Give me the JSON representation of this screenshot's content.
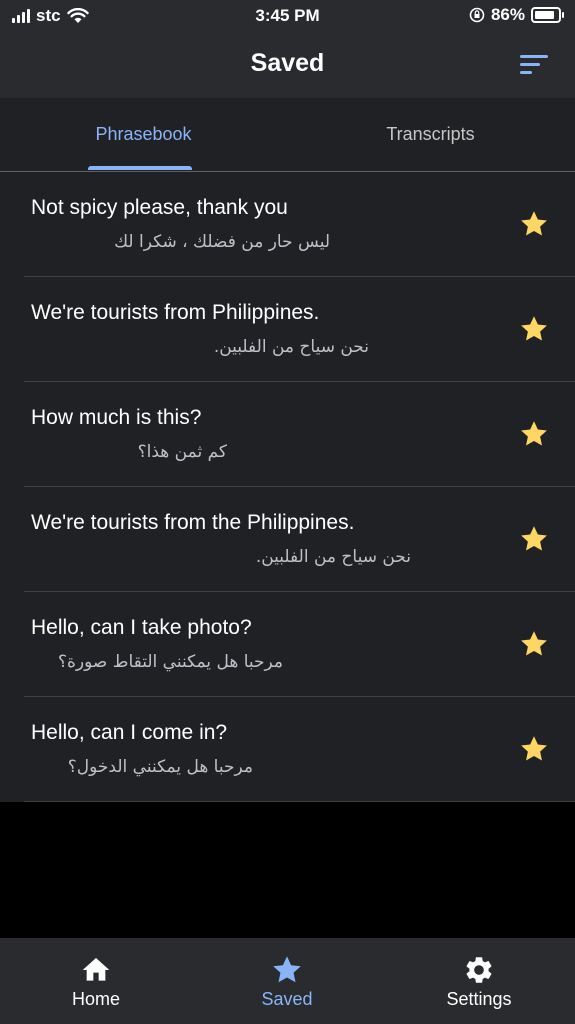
{
  "status_bar": {
    "carrier": "stc",
    "time": "3:45 PM",
    "battery_percent": "86%",
    "battery_level": 0.86
  },
  "header": {
    "title": "Saved",
    "sort_icon": "sort-icon"
  },
  "tabs": [
    {
      "label": "Phrasebook",
      "selected": true
    },
    {
      "label": "Transcripts",
      "selected": false
    }
  ],
  "phrases": [
    {
      "source": "Not spicy please, thank you",
      "translation": "ليس حار من فضلك ، شكرا لك",
      "starred": true
    },
    {
      "source": "We're tourists from Philippines.",
      "translation": "نحن سياح من الفلبين.",
      "starred": true
    },
    {
      "source": "How much is this?",
      "translation": "كم ثمن هذا؟",
      "starred": true
    },
    {
      "source": "We're tourists from the Philippines.",
      "translation": "نحن سياح من الفلبين.",
      "starred": true
    },
    {
      "source": "Hello, can I take photo?",
      "translation": "مرحبا هل يمكنني التقاط صورة؟",
      "starred": true
    },
    {
      "source": "Hello, can I come in?",
      "translation": "مرحبا هل يمكنني الدخول؟",
      "starred": true
    }
  ],
  "bottom_nav": [
    {
      "label": "Home",
      "icon": "home-icon",
      "selected": false
    },
    {
      "label": "Saved",
      "icon": "star-icon",
      "selected": true
    },
    {
      "label": "Settings",
      "icon": "gear-icon",
      "selected": false
    }
  ],
  "colors": {
    "accent": "#8ab4f8",
    "star": "#fdd663",
    "background": "#202124",
    "bar": "#2a2b2e"
  }
}
